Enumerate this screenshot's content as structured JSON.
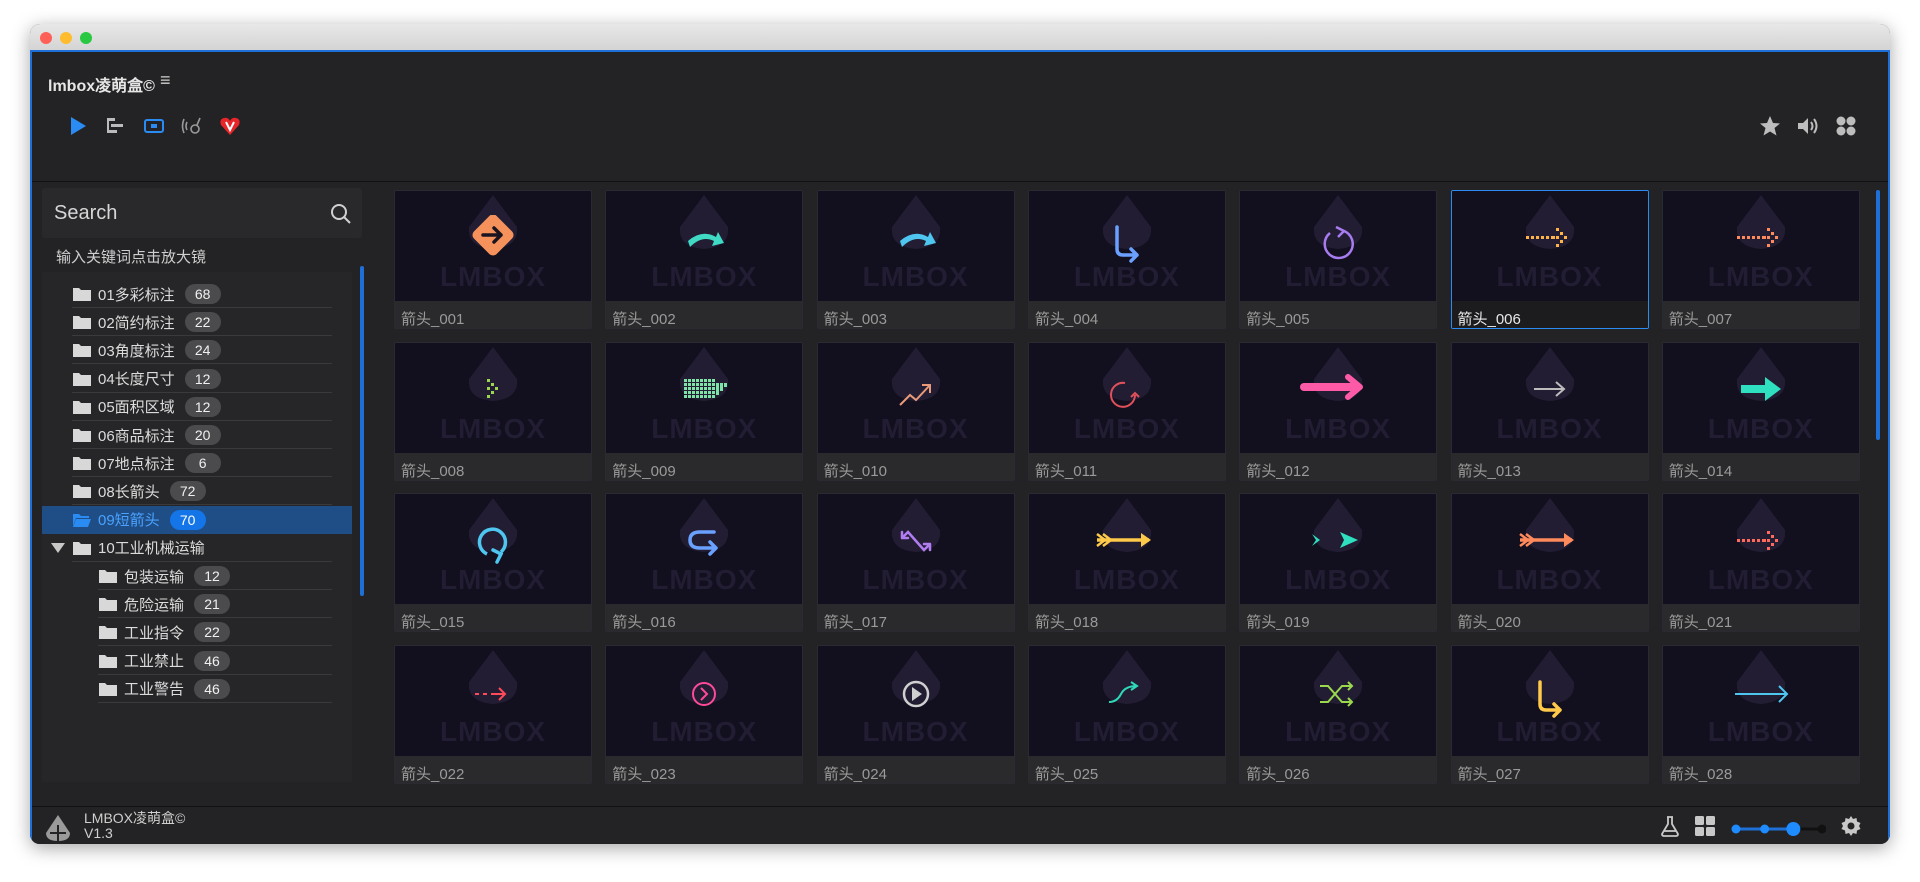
{
  "app": {
    "title": "lmbox凌萌盒©",
    "menu_icon": "hamburger-icon"
  },
  "toolbar": {
    "left_icons": [
      "play-icon",
      "timeline-icon",
      "capture-icon",
      "signal-icon",
      "vip-heart-icon"
    ],
    "right_icons": [
      "star-icon",
      "volume-icon",
      "grid-flower-icon"
    ]
  },
  "search": {
    "placeholder": "Search",
    "hint": "输入关键词点击放大镜"
  },
  "tree": [
    {
      "label": "01多彩标注",
      "count": "68",
      "level": 1
    },
    {
      "label": "02简约标注",
      "count": "22",
      "level": 1
    },
    {
      "label": "03角度标注",
      "count": "24",
      "level": 1
    },
    {
      "label": "04长度尺寸",
      "count": "12",
      "level": 1
    },
    {
      "label": "05面积区域",
      "count": "12",
      "level": 1
    },
    {
      "label": "06商品标注",
      "count": "20",
      "level": 1
    },
    {
      "label": "07地点标注",
      "count": "6",
      "level": 1
    },
    {
      "label": "08长箭头",
      "count": "72",
      "level": 1
    },
    {
      "label": "09短箭头",
      "count": "70",
      "level": 1,
      "selected": true
    },
    {
      "label": "10工业机械运输",
      "count": "",
      "level": 1,
      "expanded": true
    },
    {
      "label": "包装运输",
      "count": "12",
      "level": 2
    },
    {
      "label": "危险运输",
      "count": "21",
      "level": 2
    },
    {
      "label": "工业指令",
      "count": "22",
      "level": 2
    },
    {
      "label": "工业禁止",
      "count": "46",
      "level": 2
    },
    {
      "label": "工业警告",
      "count": "46",
      "level": 2
    }
  ],
  "watermark": "LMBOX",
  "cards": [
    {
      "label": "箭头_001",
      "icon": "diamond-arrow-icon",
      "color": "#f5925c"
    },
    {
      "label": "箭头_002",
      "icon": "curved-arrow-icon",
      "color": "#3fd9c4"
    },
    {
      "label": "箭头_003",
      "icon": "curved-arrow-icon",
      "color": "#4ec6f0"
    },
    {
      "label": "箭头_004",
      "icon": "turn-down-right-icon",
      "color": "#6aa0ff"
    },
    {
      "label": "箭头_005",
      "icon": "refresh-icon",
      "color": "#a67cf0"
    },
    {
      "label": "箭头_006",
      "icon": "dotted-arrow-icon",
      "color": "#ffb347",
      "selected": true
    },
    {
      "label": "箭头_007",
      "icon": "dotted-arrow-icon",
      "color": "#ff8a5c"
    },
    {
      "label": "箭头_008",
      "icon": "dotted-chevron-icon",
      "color": "#9bd84e"
    },
    {
      "label": "箭头_009",
      "icon": "pixel-arrow-icon",
      "color": "#7ee3a6"
    },
    {
      "label": "箭头_010",
      "icon": "trend-up-icon",
      "color": "#e89a7a"
    },
    {
      "label": "箭头_011",
      "icon": "rotate-icon",
      "color": "#e0505a"
    },
    {
      "label": "箭头_012",
      "icon": "bold-arrow-icon",
      "color": "#ff5aa8"
    },
    {
      "label": "箭头_013",
      "icon": "thin-arrow-icon",
      "color": "#bdbdbd"
    },
    {
      "label": "箭头_014",
      "icon": "solid-arrow-icon",
      "color": "#2ee0c0"
    },
    {
      "label": "箭头_015",
      "icon": "loop-arrow-icon",
      "color": "#4ec6f0"
    },
    {
      "label": "箭头_016",
      "icon": "u-turn-icon",
      "color": "#6aa0ff"
    },
    {
      "label": "箭头_017",
      "icon": "zigzag-arrow-icon",
      "color": "#b07cf0"
    },
    {
      "label": "箭头_018",
      "icon": "feather-arrow-icon",
      "color": "#ffc94a"
    },
    {
      "label": "箭头_019",
      "icon": "dart-arrow-icon",
      "color": "#2ee0c0"
    },
    {
      "label": "箭头_020",
      "icon": "feather-arrow-icon",
      "color": "#ff8a5c"
    },
    {
      "label": "箭头_021",
      "icon": "dotted-arrow-icon",
      "color": "#ff6a5c"
    },
    {
      "label": "箭头_022",
      "icon": "dashed-arrow-icon",
      "color": "#ff4a5a"
    },
    {
      "label": "箭头_023",
      "icon": "circle-chevron-icon",
      "color": "#ff4a9a"
    },
    {
      "label": "箭头_024",
      "icon": "play-circle-icon",
      "color": "#d0d0d0"
    },
    {
      "label": "箭头_025",
      "icon": "s-curve-arrow-icon",
      "color": "#2ed8b8"
    },
    {
      "label": "箭头_026",
      "icon": "shuffle-icon",
      "color": "#9bd84e"
    },
    {
      "label": "箭头_027",
      "icon": "turn-down-right-icon",
      "color": "#ffc94a"
    },
    {
      "label": "箭头_028",
      "icon": "long-arrow-icon",
      "color": "#4ec6f0"
    }
  ],
  "footer": {
    "name": "LMBOX凌萌盒©",
    "version": "V1.3",
    "right_icons": [
      "flask-icon",
      "grid-icon",
      "zoom-slider",
      "gear-icon"
    ],
    "zoom_level_step": 3,
    "zoom_steps": 4
  },
  "colors": {
    "accent": "#1e6fd6",
    "selected_bg": "#1f4e86",
    "badge_selected": "#1475e8"
  }
}
